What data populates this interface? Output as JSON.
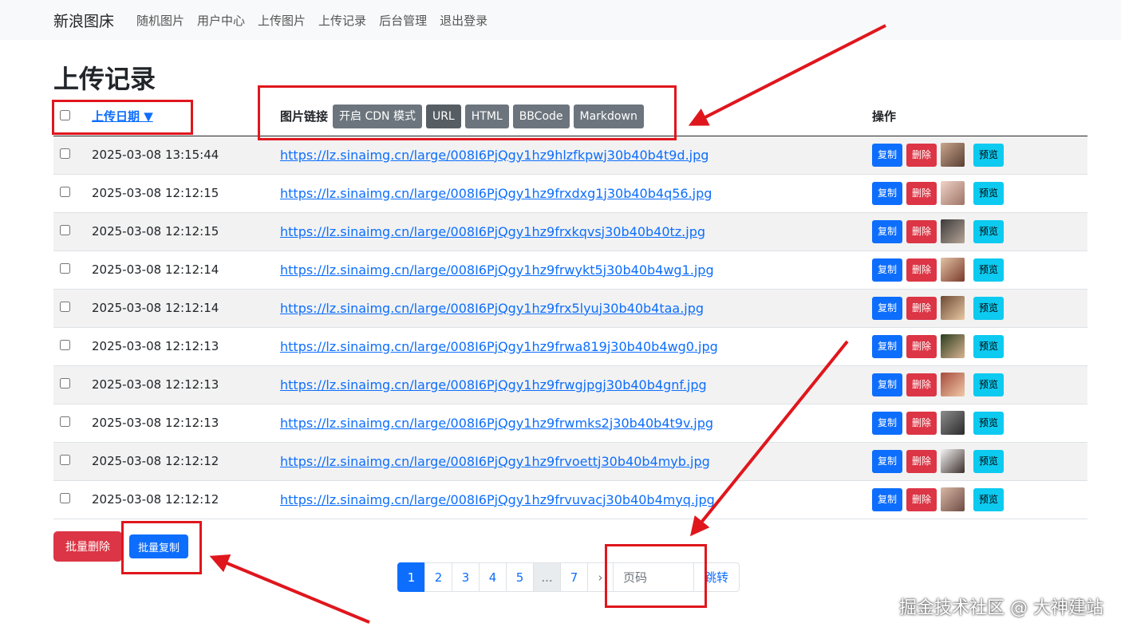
{
  "navbar": {
    "brand": "新浪图床",
    "links": [
      "随机图片",
      "用户中心",
      "上传图片",
      "上传记录",
      "后台管理",
      "退出登录"
    ]
  },
  "page_title": "上传记录",
  "table": {
    "date_header": "上传日期 ▼",
    "link_header": "图片链接",
    "ops_header": "操作",
    "format_buttons": [
      "开启 CDN 模式",
      "URL",
      "HTML",
      "BBCode",
      "Markdown"
    ],
    "active_format": "URL",
    "copy_label": "复制",
    "delete_label": "删除",
    "preview_label": "预览",
    "rows": [
      {
        "date": "2025-03-08 13:15:44",
        "url": "https://lz.sinaimg.cn/large/008I6PjQgy1hz9hlzfkpwj30b40b4t9d.jpg"
      },
      {
        "date": "2025-03-08 12:12:15",
        "url": "https://lz.sinaimg.cn/large/008I6PjQgy1hz9frxdxg1j30b40b4q56.jpg"
      },
      {
        "date": "2025-03-08 12:12:15",
        "url": "https://lz.sinaimg.cn/large/008I6PjQgy1hz9frxkqvsj30b40b40tz.jpg"
      },
      {
        "date": "2025-03-08 12:12:14",
        "url": "https://lz.sinaimg.cn/large/008I6PjQgy1hz9frwykt5j30b40b4wg1.jpg"
      },
      {
        "date": "2025-03-08 12:12:14",
        "url": "https://lz.sinaimg.cn/large/008I6PjQgy1hz9frx5lyuj30b40b4taa.jpg"
      },
      {
        "date": "2025-03-08 12:12:13",
        "url": "https://lz.sinaimg.cn/large/008I6PjQgy1hz9frwa819j30b40b4wg0.jpg"
      },
      {
        "date": "2025-03-08 12:12:13",
        "url": "https://lz.sinaimg.cn/large/008I6PjQgy1hz9frwgjpgj30b40b4gnf.jpg"
      },
      {
        "date": "2025-03-08 12:12:13",
        "url": "https://lz.sinaimg.cn/large/008I6PjQgy1hz9frwmks2j30b40b4t9v.jpg"
      },
      {
        "date": "2025-03-08 12:12:12",
        "url": "https://lz.sinaimg.cn/large/008I6PjQgy1hz9frvoettj30b40b4myb.jpg"
      },
      {
        "date": "2025-03-08 12:12:12",
        "url": "https://lz.sinaimg.cn/large/008I6PjQgy1hz9frvuvacj30b40b4myq.jpg"
      }
    ]
  },
  "bulk": {
    "delete_label": "批量删除",
    "copy_label": "批量复制"
  },
  "pagination": {
    "pages": [
      "1",
      "2",
      "3",
      "4",
      "5",
      "...",
      "7"
    ],
    "current": "1",
    "next": "›",
    "input_placeholder": "页码",
    "go_label": "跳转"
  },
  "watermark": "掘金技术社区 @ 大神建站",
  "colors": {
    "primary": "#0d6efd",
    "danger": "#dc3545",
    "info": "#0dcaf0",
    "secondary": "#6c757d",
    "annotation": "#e0161d"
  }
}
